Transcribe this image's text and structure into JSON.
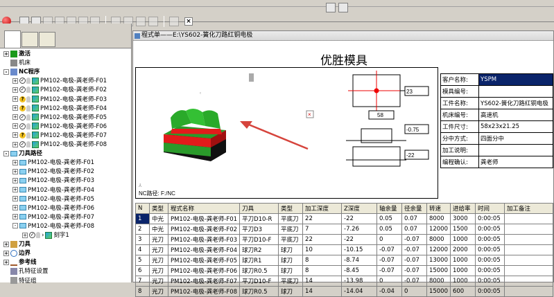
{
  "tree": {
    "items": [
      {
        "label": "激活"
      },
      {
        "label": "机床"
      },
      {
        "label": "NC程序"
      },
      {
        "label": "PM102-电极-龚老师-F01"
      },
      {
        "label": "PM102-电极-龚老师-F02"
      },
      {
        "label": "PM102-电极-龚老师-F03"
      },
      {
        "label": "PM102-电极-龚老师-F04"
      },
      {
        "label": "PM102-电极-龚老师-F05"
      },
      {
        "label": "PM102-电极-龚老师-F06"
      },
      {
        "label": "PM102-电极-龚老师-F07"
      },
      {
        "label": "PM102-电极-龚老师-F08"
      },
      {
        "label": "刀具路径"
      },
      {
        "label": "PM102-电极-龚老师-F01"
      },
      {
        "label": "PM102-电极-龚老师-F02"
      },
      {
        "label": "PM102-电极-龚老师-F03"
      },
      {
        "label": "PM102-电极-龚老师-F04"
      },
      {
        "label": "PM102-电极-龚老师-F05"
      },
      {
        "label": "PM102-电极-龚老师-F06"
      },
      {
        "label": "PM102-电极-龚老师-F07"
      },
      {
        "label": "PM102-电极-龚老师-F08"
      },
      {
        "label": "刻字1"
      },
      {
        "label": "刀具"
      },
      {
        "label": "边界"
      },
      {
        "label": "参考线"
      },
      {
        "label": "孔特征设置"
      },
      {
        "label": "特征组"
      }
    ]
  },
  "window": {
    "title": "程式单——E:\\YS602-簧化刀路红铜电极"
  },
  "doc": {
    "title": "优胜模具",
    "nc_path": "NC路径: F:/NC",
    "dims": {
      "d1": "23",
      "d2": "58",
      "d3": "-0.75",
      "d4": "-22"
    }
  },
  "info": [
    {
      "k": "客户名称:",
      "v": "YSPM"
    },
    {
      "k": "模具编号:",
      "v": ""
    },
    {
      "k": "工件名称:",
      "v": "YS602-簧化刀路红铜电极"
    },
    {
      "k": "机床编号:",
      "v": "高速机"
    },
    {
      "k": "工件尺寸:",
      "v": "58x23x21.25"
    },
    {
      "k": "分中方式:",
      "v": "四面分中"
    },
    {
      "k": "加工说明:",
      "v": ""
    },
    {
      "k": "编程确认:",
      "v": "龚老师"
    }
  ],
  "table": {
    "headers": [
      "N",
      "类型",
      "程式名称",
      "刀具",
      "类型",
      "加工深度",
      "Z深度",
      "轴余量",
      "径余量",
      "转速",
      "进给率",
      "时间",
      "加工备注"
    ],
    "rows": [
      [
        "1",
        "中光",
        "PM102-电极-龚老师-F01",
        "平刀D10-R",
        "平底刀",
        "22",
        "-22",
        "0.05",
        "0.07",
        "8000",
        "3000",
        "0:00:05",
        ""
      ],
      [
        "2",
        "中光",
        "PM102-电极-龚老师-F02",
        "平刀D3",
        "平底刀",
        "7",
        "-7.26",
        "0.05",
        "0.07",
        "12000",
        "1500",
        "0:00:05",
        ""
      ],
      [
        "3",
        "光刀",
        "PM102-电极-龚老师-F03",
        "平刀D10-F",
        "平底刀",
        "22",
        "-22",
        "0",
        "-0.07",
        "8000",
        "1000",
        "0:00:05",
        ""
      ],
      [
        "4",
        "光刀",
        "PM102-电极-龚老师-F04",
        "球刀R2",
        "球刀",
        "10",
        "-10.15",
        "-0.07",
        "-0.07",
        "12000",
        "2000",
        "0:00:05",
        ""
      ],
      [
        "5",
        "光刀",
        "PM102-电极-龚老师-F05",
        "球刀R1",
        "球刀",
        "8",
        "-8.74",
        "-0.07",
        "-0.07",
        "13000",
        "1000",
        "0:00:05",
        ""
      ],
      [
        "6",
        "光刀",
        "PM102-电极-龚老师-F06",
        "球刀R0.5",
        "球刀",
        "8",
        "-8.45",
        "-0.07",
        "-0.07",
        "15000",
        "1000",
        "0:00:05",
        ""
      ],
      [
        "7",
        "光刀",
        "PM102-电极-龚老师-F07",
        "平刀D10-F",
        "平底刀",
        "14",
        "-13.98",
        "0",
        "-0.07",
        "8000",
        "1000",
        "0:00:05",
        ""
      ],
      [
        "8",
        "光刀",
        "PM102-电极-龚老师-F08",
        "球刀R0.5",
        "球刀",
        "14",
        "-14.04",
        "-0.04",
        "0",
        "15000",
        "600",
        "0:00:05",
        ""
      ]
    ]
  }
}
